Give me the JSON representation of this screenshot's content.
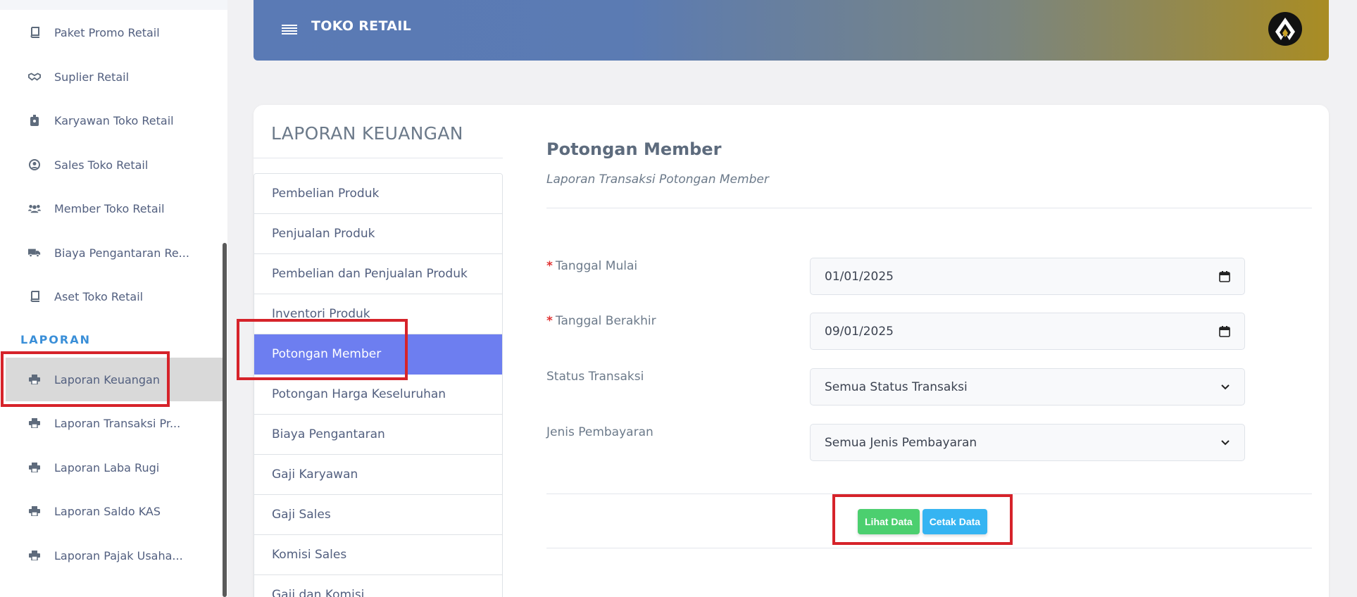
{
  "sidebar": {
    "items": [
      {
        "label": "Paket Promo Retail",
        "icon": "book-icon"
      },
      {
        "label": "Suplier Retail",
        "icon": "handshake-icon"
      },
      {
        "label": "Karyawan Toko Retail",
        "icon": "badge-icon"
      },
      {
        "label": "Sales Toko Retail",
        "icon": "user-circle-icon"
      },
      {
        "label": "Member Toko Retail",
        "icon": "users-icon"
      },
      {
        "label": "Biaya Pengantaran Re...",
        "icon": "truck-icon"
      },
      {
        "label": "Aset Toko Retail",
        "icon": "book-icon"
      }
    ],
    "section_heading": "LAPORAN",
    "report_items": [
      {
        "label": "Laporan Keuangan",
        "icon": "print-icon",
        "active": true
      },
      {
        "label": "Laporan Transaksi Pr...",
        "icon": "print-icon"
      },
      {
        "label": "Laporan Laba Rugi",
        "icon": "print-icon"
      },
      {
        "label": "Laporan Saldo KAS",
        "icon": "print-icon"
      },
      {
        "label": "Laporan Pajak Usaha...",
        "icon": "print-icon"
      }
    ]
  },
  "header": {
    "title": "TOKO RETAIL"
  },
  "card": {
    "heading": "LAPORAN KEUANGAN",
    "menu": [
      "Pembelian Produk",
      "Penjualan Produk",
      "Pembelian dan Penjualan Produk",
      "Inventori Produk",
      "Potongan Member",
      "Potongan Harga Keseluruhan",
      "Biaya Pengantaran",
      "Gaji Karyawan",
      "Gaji Sales",
      "Komisi Sales",
      "Gaji dan Komisi"
    ],
    "active_menu": "Potongan Member"
  },
  "panel": {
    "title": "Potongan Member",
    "subtitle": "Laporan Transaksi Potongan Member",
    "required_mark": "*",
    "fields": {
      "start_label": "Tanggal Mulai",
      "start_value": "01/01/2025",
      "end_label": "Tanggal Berakhir",
      "end_value": "09/01/2025",
      "status_label": "Status Transaksi",
      "status_value": "Semua Status Transaksi",
      "payment_label": "Jenis Pembayaran",
      "payment_value": "Semua Jenis Pembayaran"
    },
    "buttons": {
      "view": "Lihat Data",
      "print": "Cetak Data"
    }
  },
  "colors": {
    "highlight": "#d6232a",
    "active_menu": "#6d7ef0",
    "btn_view": "#4ccf6f",
    "btn_print": "#35b4f2"
  }
}
